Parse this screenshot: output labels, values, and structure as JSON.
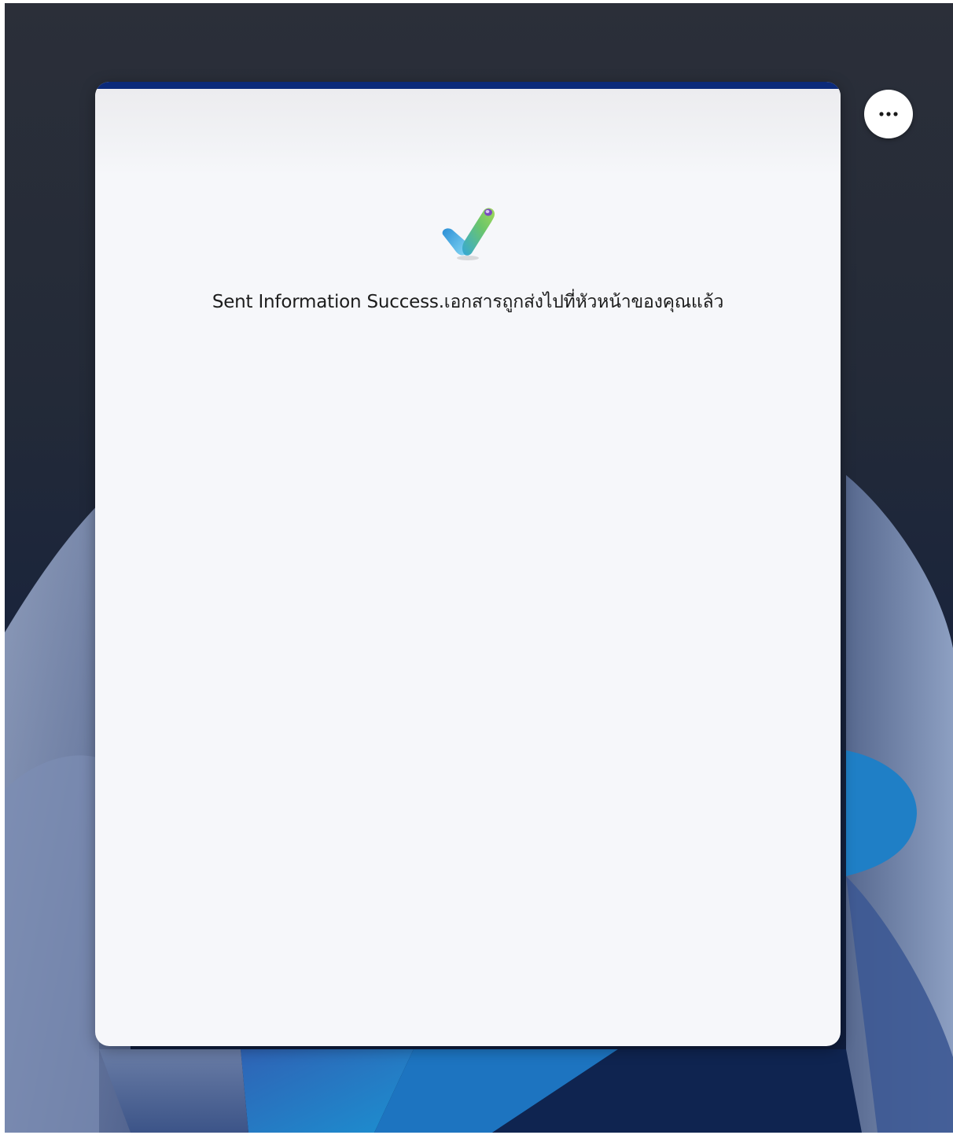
{
  "window": {
    "more_button_label": "More options",
    "more_icon": "more-horizontal-icon"
  },
  "dialog": {
    "icon": "checkmark-icon",
    "message": "Sent Information Success.เอกสารถูกส่งไปที่หัวหน้าของคุณแล้ว"
  },
  "colors": {
    "accent_bar": "#0b2a7a",
    "card_background": "#f6f7fa",
    "text": "#1c1c1c"
  }
}
